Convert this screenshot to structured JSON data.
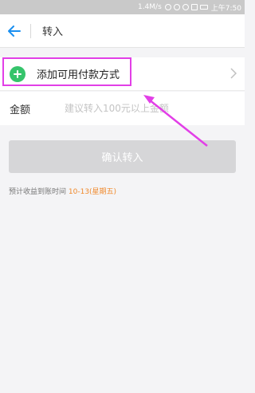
{
  "status_bar": {
    "network_speed": "1.4M/s",
    "time": "上午7:50"
  },
  "nav": {
    "title": "转入"
  },
  "payment_method": {
    "label": "添加可用付款方式"
  },
  "amount": {
    "label": "金额",
    "placeholder": "建议转入100元以上金额"
  },
  "confirm_button": {
    "label": "确认转入"
  },
  "arrival": {
    "prefix": "预计收益到账时间",
    "date": "10-13(星期五)"
  },
  "colors": {
    "accent_blue": "#1a8ff0",
    "add_green": "#35c46b",
    "date_orange": "#f0892b",
    "annotation_magenta": "#e23fe7"
  },
  "icons": [
    "back-arrow-icon",
    "add-circle-icon",
    "chevron-right-icon"
  ]
}
